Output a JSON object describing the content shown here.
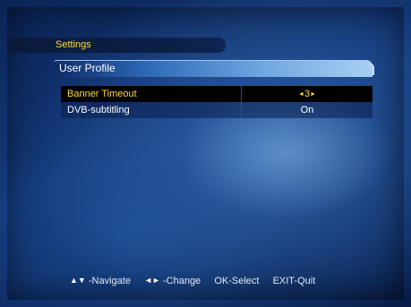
{
  "menu": {
    "title": "Settings",
    "section": "User Profile",
    "rows": [
      {
        "label": "Banner Timeout",
        "value": "3",
        "value_left_arrow": "◄",
        "value_right_arrow": "►",
        "selected": true
      },
      {
        "label": "DVB-subtitling",
        "value": "On",
        "selected": false
      }
    ]
  },
  "footer": {
    "navigate_keys": "▲▼",
    "navigate_label": "-Navigate",
    "change_keys": "◄►",
    "change_label": "-Change",
    "select_label": "OK-Select",
    "quit_label": "EXIT-Quit"
  },
  "colors": {
    "accent_text": "#ffd84a",
    "selected_row_bg": "#000000",
    "background": "#143a7c"
  }
}
